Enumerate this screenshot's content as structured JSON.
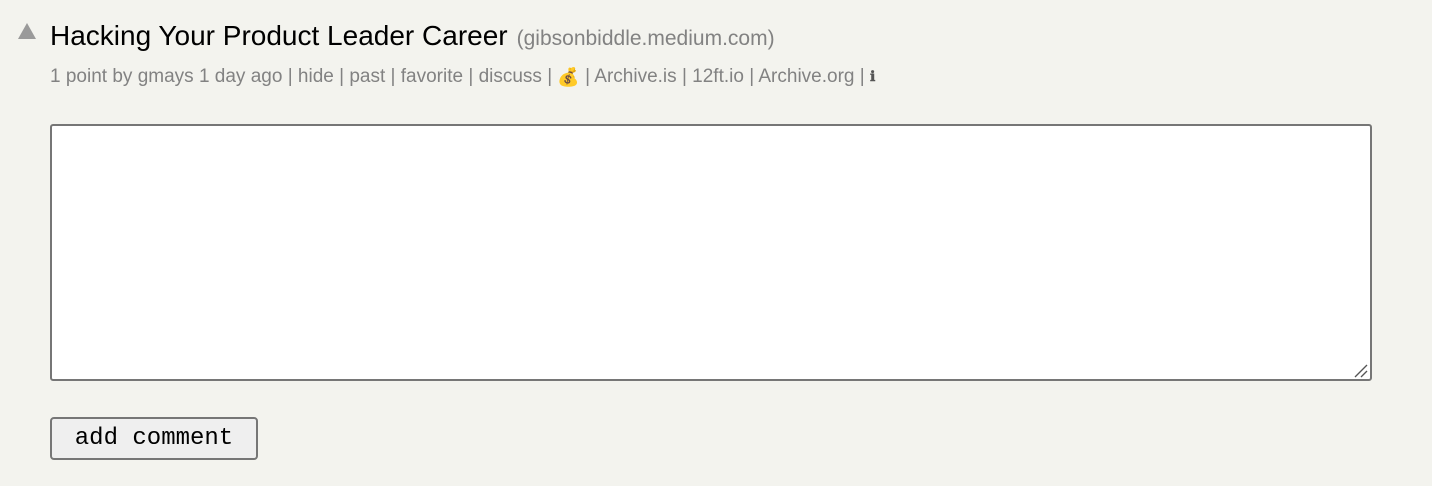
{
  "story": {
    "title": "Hacking Your Product Leader Career",
    "site": "(gibsonbiddle.medium.com)"
  },
  "subtext": {
    "points": "1 point",
    "by_label": "by",
    "user": "gmays",
    "age": "1 day ago",
    "separator": "|",
    "hide": "hide",
    "past": "past",
    "favorite": "favorite",
    "discuss": "discuss",
    "money_emoji": "💰",
    "archive_is": "Archive.is",
    "twelve_ft": "12ft.io",
    "archive_org": "Archive.org",
    "info_glyph": "ℹ"
  },
  "comment": {
    "text_value": "",
    "submit_label": "add comment"
  },
  "icons": {
    "upvote": "upvote-arrow-icon",
    "money": "money-bag-icon",
    "info": "info-icon",
    "resize": "resize-grip-icon"
  },
  "colors": {
    "background": "#f3f3ee",
    "meta_text": "#828282",
    "title_text": "#000000"
  }
}
